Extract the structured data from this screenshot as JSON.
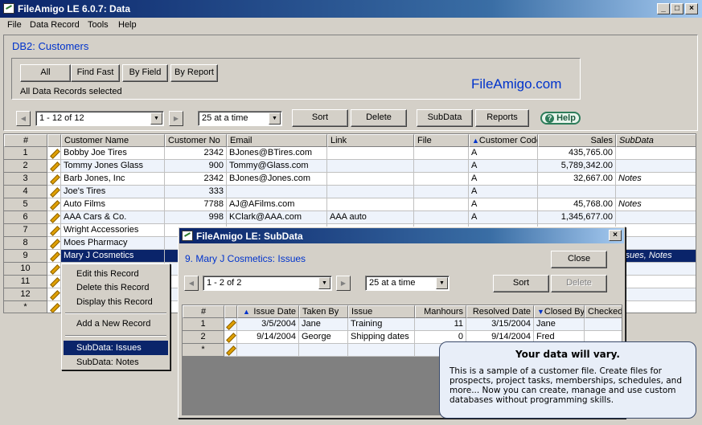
{
  "window": {
    "title": "FileAmigo LE 6.0.7: Data"
  },
  "menu": [
    "File",
    "Data Record",
    "Tools",
    "Help"
  ],
  "db_title": "DB2: Customers",
  "selection_buttons": [
    "All",
    "Find Fast",
    "By Field",
    "By Report"
  ],
  "status": "All Data Records selected",
  "brand": "FileAmigo.com",
  "toolbar": {
    "range": "1 - 12 of 12",
    "page_size": "25 at a time",
    "sort": "Sort",
    "delete": "Delete",
    "subdata": "SubData",
    "reports": "Reports",
    "help": "Help"
  },
  "grid": {
    "columns": [
      "#",
      "",
      "Customer Name",
      "Customer No",
      "Email",
      "Link",
      "File",
      "Customer Code",
      "Sales",
      "SubData"
    ],
    "rows": [
      {
        "num": "1",
        "name": "Bobby Joe Tires",
        "no": "2342",
        "email": "BJones@BTires.com",
        "link": "",
        "code": "A",
        "sales": "435,765.00",
        "subdata": ""
      },
      {
        "num": "2",
        "name": "Tommy Jones Glass",
        "no": "900",
        "email": "Tommy@Glass.com",
        "link": "",
        "code": "A",
        "sales": "5,789,342.00",
        "subdata": ""
      },
      {
        "num": "3",
        "name": "Barb Jones, Inc",
        "no": "2342",
        "email": "BJones@Jones.com",
        "link": "",
        "code": "A",
        "sales": "32,667.00",
        "subdata": "Notes"
      },
      {
        "num": "4",
        "name": "Joe's Tires",
        "no": "333",
        "email": "",
        "link": "",
        "code": "A",
        "sales": "",
        "subdata": ""
      },
      {
        "num": "5",
        "name": "Auto Films",
        "no": "7788",
        "email": "AJ@AFilms.com",
        "link": "",
        "code": "A",
        "sales": "45,768.00",
        "subdata": "Notes"
      },
      {
        "num": "6",
        "name": "AAA Cars & Co.",
        "no": "998",
        "email": "KClark@AAA.com",
        "link": "AAA auto",
        "code": "A",
        "sales": "1,345,677.00",
        "subdata": ""
      },
      {
        "num": "7",
        "name": "Wright Accessories",
        "no": "",
        "email": "",
        "link": "",
        "code": "",
        "sales": "",
        "subdata": ""
      },
      {
        "num": "8",
        "name": "Moes Pharmacy",
        "no": "",
        "email": "",
        "link": "",
        "code": "",
        "sales": "",
        "subdata": ""
      },
      {
        "num": "9",
        "name": "Mary J Cosmetics",
        "no": "",
        "email": "",
        "link": "",
        "code": "",
        "sales": "",
        "subdata": "Issues, Notes"
      },
      {
        "num": "10",
        "name": "",
        "no": "",
        "email": "",
        "link": "",
        "code": "",
        "sales": "",
        "subdata": ""
      },
      {
        "num": "11",
        "name": "",
        "no": "",
        "email": "",
        "link": "",
        "code": "",
        "sales": "",
        "subdata": ""
      },
      {
        "num": "12",
        "name": "",
        "no": "",
        "email": "",
        "link": "",
        "code": "",
        "sales": "",
        "subdata": ""
      },
      {
        "num": "*",
        "name": "",
        "no": "",
        "email": "",
        "link": "",
        "code": "",
        "sales": "",
        "subdata": ""
      }
    ]
  },
  "context_menu": [
    "Edit this Record",
    "Delete this Record",
    "Display this Record",
    "Add a New Record",
    "SubData: Issues",
    "SubData: Notes"
  ],
  "subdata": {
    "title": "FileAmigo LE: SubData",
    "heading": "9. Mary J Cosmetics: Issues",
    "close": "Close",
    "range": "1 - 2 of 2",
    "page_size": "25 at a time",
    "sort": "Sort",
    "delete": "Delete",
    "columns": [
      "#",
      "",
      "Issue Date",
      "Taken By",
      "Issue",
      "Manhours",
      "Resolved Date",
      "Closed By",
      "Checked"
    ],
    "rows": [
      {
        "num": "1",
        "issue_date": "3/5/2004",
        "taken_by": "Jane",
        "issue": "Training",
        "manhours": "11",
        "resolved": "3/15/2004",
        "closed_by": "Jane",
        "checked": ""
      },
      {
        "num": "2",
        "issue_date": "9/14/2004",
        "taken_by": "George",
        "issue": "Shipping dates",
        "manhours": "0",
        "resolved": "9/14/2004",
        "closed_by": "Fred",
        "checked": ""
      },
      {
        "num": "*",
        "issue_date": "",
        "taken_by": "",
        "issue": "",
        "manhours": "",
        "resolved": "",
        "closed_by": "",
        "checked": ""
      }
    ]
  },
  "tooltip": {
    "title": "Your data will vary.",
    "body": "This is a sample of a customer file. Create files for prospects, project tasks, memberships, schedules, and more... Now you can create, manage and use custom databases without programming skills."
  },
  "colors": {
    "accent": "#0033cc",
    "titlebar": "#0a246a",
    "selection": "#0a246a",
    "help_green": "#2e7d5b"
  }
}
